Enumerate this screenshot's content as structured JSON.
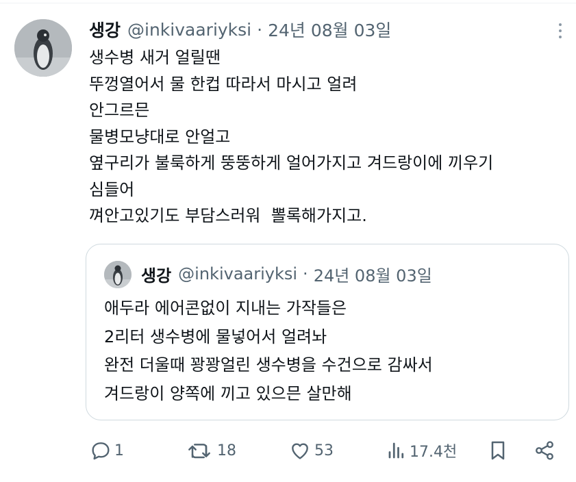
{
  "tweet": {
    "author": {
      "display_name": "생강",
      "handle": "@inkivaariyksi"
    },
    "separator": "·",
    "date": "24년 08월 03일",
    "lines": [
      "생수병 새거 얼릴땐",
      "뚜껑열어서 물 한컵 따라서 마시고 얼려",
      "안그르믄",
      "물병모냥대로 안얼고",
      "옆구리가 불룩하게 뚱뚱하게 얼어가지고 겨드랑이에 끼우기",
      "심들어",
      "껴안고있기도 부담스러워  뽈록해가지고."
    ]
  },
  "quote": {
    "author": {
      "display_name": "생강",
      "handle": "@inkivaariyksi"
    },
    "separator": "·",
    "date": "24년 08월 03일",
    "lines": [
      "애두라 에어콘없이 지내는 가작들은",
      "2리터 생수병에 물넣어서 얼려놔",
      "완전 더울때 꽝꽝얼린 생수병을 수건으로 감싸서",
      "겨드랑이 양쪽에 끼고 있으믄 살만해"
    ]
  },
  "actions": {
    "reply": {
      "icon": "reply-icon",
      "count": "1"
    },
    "repost": {
      "icon": "repost-icon",
      "count": "18"
    },
    "like": {
      "icon": "heart-icon",
      "count": "53"
    },
    "views": {
      "icon": "views-icon",
      "count": "17.4천"
    },
    "bookmark": {
      "icon": "bookmark-icon"
    },
    "share": {
      "icon": "share-icon"
    }
  },
  "colors": {
    "text_primary": "#0f1419",
    "text_secondary": "#536471",
    "border": "#cfd9de"
  }
}
